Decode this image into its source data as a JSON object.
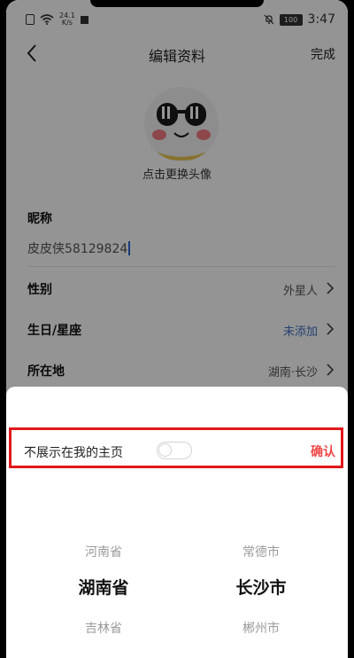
{
  "status_bar": {
    "speed_value": "24.1",
    "speed_unit": "K/s",
    "battery": "100",
    "time": "3:47"
  },
  "header": {
    "title": "编辑资料",
    "done_label": "完成"
  },
  "avatar": {
    "caption": "点击更换头像"
  },
  "form": {
    "nickname_label": "昵称",
    "nickname_value": "皮皮侠58129824",
    "gender_label": "性别",
    "gender_value": "外星人",
    "birthday_label": "生日/星座",
    "birthday_value": "未添加",
    "location_label": "所在地",
    "location_value": "湖南·长沙"
  },
  "location_picker": {
    "hide_label": "不展示在我的主页",
    "hide_toggle_on": false,
    "confirm_label": "确认",
    "provinces": [
      "河南省",
      "湖南省",
      "吉林省"
    ],
    "cities": [
      "常德市",
      "长沙市",
      "郴州市"
    ],
    "selected_province": "湖南省",
    "selected_city": "长沙市"
  },
  "colors": {
    "accent_red": "#f04848",
    "highlight_border": "#e0191c",
    "link_blue": "#3e6fc4"
  }
}
